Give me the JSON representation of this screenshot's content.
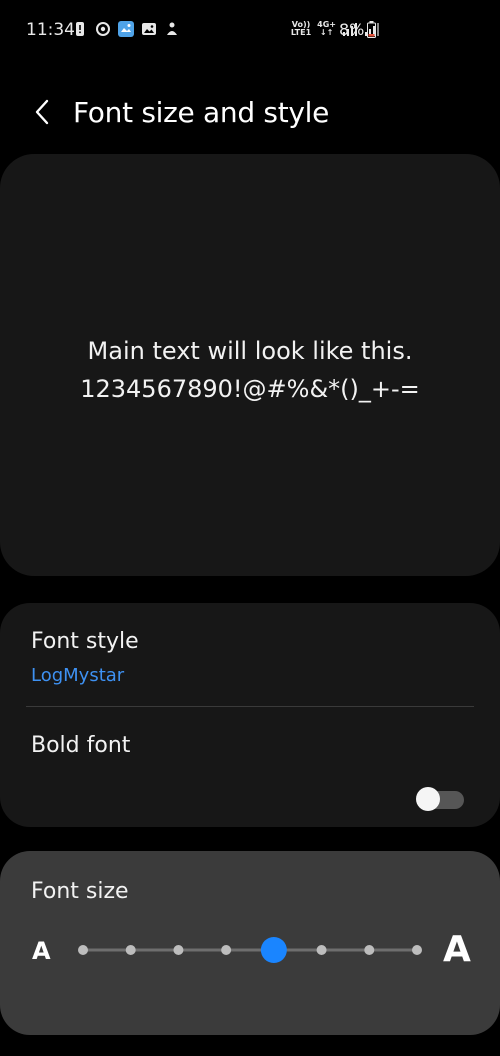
{
  "status_bar": {
    "time": "11:34",
    "volte_line1": "Vo))",
    "volte_line2": "LTE1",
    "network_type": "4G+",
    "battery": "8%",
    "icons": [
      "alert-icon",
      "sync-icon",
      "gallery-app-icon",
      "image-icon",
      "cleaner-icon",
      "signal-icon",
      "signal-icon",
      "battery-low-icon"
    ]
  },
  "header": {
    "back_icon": "chevron-left-icon",
    "title": "Font size and style"
  },
  "preview": {
    "line1": "Main text will look like this.",
    "line2": "1234567890!@#%&*()_+-="
  },
  "font_style": {
    "label": "Font style",
    "value": "LogMystar"
  },
  "bold_font": {
    "label": "Bold font",
    "enabled": false
  },
  "font_size": {
    "label": "Font size",
    "small_marker": "A",
    "large_marker": "A",
    "levels": 8,
    "selected_index": 4
  },
  "colors": {
    "accent": "#3e91f2",
    "slider_thumb": "#1a85ff",
    "background": "#000000",
    "card": "#171717",
    "active_card": "#3b3b3b"
  }
}
